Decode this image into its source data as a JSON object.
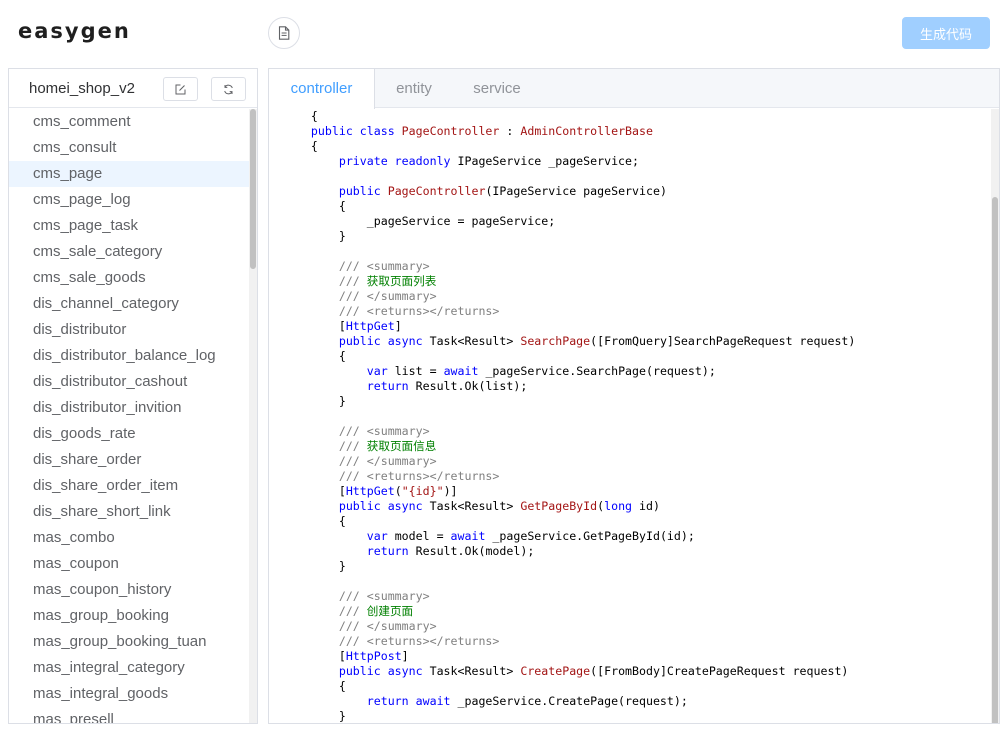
{
  "header": {
    "logo": "easygen",
    "generate_label": "生成代码"
  },
  "sidebar": {
    "db_name": "homei_shop_v2",
    "active_index": 2,
    "tables": [
      "cms_comment",
      "cms_consult",
      "cms_page",
      "cms_page_log",
      "cms_page_task",
      "cms_sale_category",
      "cms_sale_goods",
      "dis_channel_category",
      "dis_distributor",
      "dis_distributor_balance_log",
      "dis_distributor_cashout",
      "dis_distributor_invition",
      "dis_goods_rate",
      "dis_share_order",
      "dis_share_order_item",
      "dis_share_short_link",
      "mas_combo",
      "mas_coupon",
      "mas_coupon_history",
      "mas_group_booking",
      "mas_group_booking_tuan",
      "mas_integral_category",
      "mas_integral_goods",
      "mas_presell"
    ]
  },
  "tabs": [
    {
      "label": "controller",
      "active": true
    },
    {
      "label": "entity",
      "active": false
    },
    {
      "label": "service",
      "active": false
    }
  ],
  "code_lines": [
    [
      [
        "tx",
        "    {"
      ]
    ],
    [
      [
        "tx",
        "    "
      ],
      [
        "kw",
        "public class "
      ],
      [
        "ty",
        "PageController"
      ],
      [
        "tx",
        " : "
      ],
      [
        "ty",
        "AdminControllerBase"
      ]
    ],
    [
      [
        "tx",
        "    {"
      ]
    ],
    [
      [
        "tx",
        "        "
      ],
      [
        "kw",
        "private readonly "
      ],
      [
        "tx",
        "IPageService _pageService;"
      ]
    ],
    [],
    [
      [
        "tx",
        "        "
      ],
      [
        "kw",
        "public "
      ],
      [
        "ty",
        "PageController"
      ],
      [
        "tx",
        "(IPageService pageService)"
      ]
    ],
    [
      [
        "tx",
        "        {"
      ]
    ],
    [
      [
        "tx",
        "            _pageService = pageService;"
      ]
    ],
    [
      [
        "tx",
        "        }"
      ]
    ],
    [],
    [
      [
        "tx",
        "        "
      ],
      [
        "cm",
        "/// <summary>"
      ]
    ],
    [
      [
        "tx",
        "        "
      ],
      [
        "cm",
        "/// "
      ],
      [
        "cz",
        "获取页面列表"
      ]
    ],
    [
      [
        "tx",
        "        "
      ],
      [
        "cm",
        "/// </summary>"
      ]
    ],
    [
      [
        "tx",
        "        "
      ],
      [
        "cm",
        "/// <returns></returns>"
      ]
    ],
    [
      [
        "tx",
        "        ["
      ],
      [
        "kw",
        "HttpGet"
      ],
      [
        "tx",
        "]"
      ]
    ],
    [
      [
        "tx",
        "        "
      ],
      [
        "kw",
        "public async "
      ],
      [
        "tx",
        "Task<Result> "
      ],
      [
        "ty",
        "SearchPage"
      ],
      [
        "tx",
        "([FromQuery]SearchPageRequest request)"
      ]
    ],
    [
      [
        "tx",
        "        {"
      ]
    ],
    [
      [
        "tx",
        "            "
      ],
      [
        "kw",
        "var "
      ],
      [
        "tx",
        "list = "
      ],
      [
        "kw",
        "await "
      ],
      [
        "tx",
        "_pageService.SearchPage(request);"
      ]
    ],
    [
      [
        "tx",
        "            "
      ],
      [
        "kw",
        "return "
      ],
      [
        "tx",
        "Result.Ok(list);"
      ]
    ],
    [
      [
        "tx",
        "        }"
      ]
    ],
    [],
    [
      [
        "tx",
        "        "
      ],
      [
        "cm",
        "/// <summary>"
      ]
    ],
    [
      [
        "tx",
        "        "
      ],
      [
        "cm",
        "/// "
      ],
      [
        "cz",
        "获取页面信息"
      ]
    ],
    [
      [
        "tx",
        "        "
      ],
      [
        "cm",
        "/// </summary>"
      ]
    ],
    [
      [
        "tx",
        "        "
      ],
      [
        "cm",
        "/// <returns></returns>"
      ]
    ],
    [
      [
        "tx",
        "        ["
      ],
      [
        "kw",
        "HttpGet"
      ],
      [
        "tx",
        "("
      ],
      [
        "ty",
        "\"{id}\""
      ],
      [
        "tx",
        ")]"
      ]
    ],
    [
      [
        "tx",
        "        "
      ],
      [
        "kw",
        "public async "
      ],
      [
        "tx",
        "Task<Result> "
      ],
      [
        "ty",
        "GetPageById"
      ],
      [
        "tx",
        "("
      ],
      [
        "kw",
        "long "
      ],
      [
        "tx",
        "id)"
      ]
    ],
    [
      [
        "tx",
        "        {"
      ]
    ],
    [
      [
        "tx",
        "            "
      ],
      [
        "kw",
        "var "
      ],
      [
        "tx",
        "model = "
      ],
      [
        "kw",
        "await "
      ],
      [
        "tx",
        "_pageService.GetPageById(id);"
      ]
    ],
    [
      [
        "tx",
        "            "
      ],
      [
        "kw",
        "return "
      ],
      [
        "tx",
        "Result.Ok(model);"
      ]
    ],
    [
      [
        "tx",
        "        }"
      ]
    ],
    [],
    [
      [
        "tx",
        "        "
      ],
      [
        "cm",
        "/// <summary>"
      ]
    ],
    [
      [
        "tx",
        "        "
      ],
      [
        "cm",
        "/// "
      ],
      [
        "cz",
        "创建页面"
      ]
    ],
    [
      [
        "tx",
        "        "
      ],
      [
        "cm",
        "/// </summary>"
      ]
    ],
    [
      [
        "tx",
        "        "
      ],
      [
        "cm",
        "/// <returns></returns>"
      ]
    ],
    [
      [
        "tx",
        "        ["
      ],
      [
        "kw",
        "HttpPost"
      ],
      [
        "tx",
        "]"
      ]
    ],
    [
      [
        "tx",
        "        "
      ],
      [
        "kw",
        "public async "
      ],
      [
        "tx",
        "Task<Result> "
      ],
      [
        "ty",
        "CreatePage"
      ],
      [
        "tx",
        "([FromBody]CreatePageRequest request)"
      ]
    ],
    [
      [
        "tx",
        "        {"
      ]
    ],
    [
      [
        "tx",
        "            "
      ],
      [
        "kw",
        "return await "
      ],
      [
        "tx",
        "_pageService.CreatePage(request);"
      ]
    ],
    [
      [
        "tx",
        "        }"
      ]
    ]
  ]
}
